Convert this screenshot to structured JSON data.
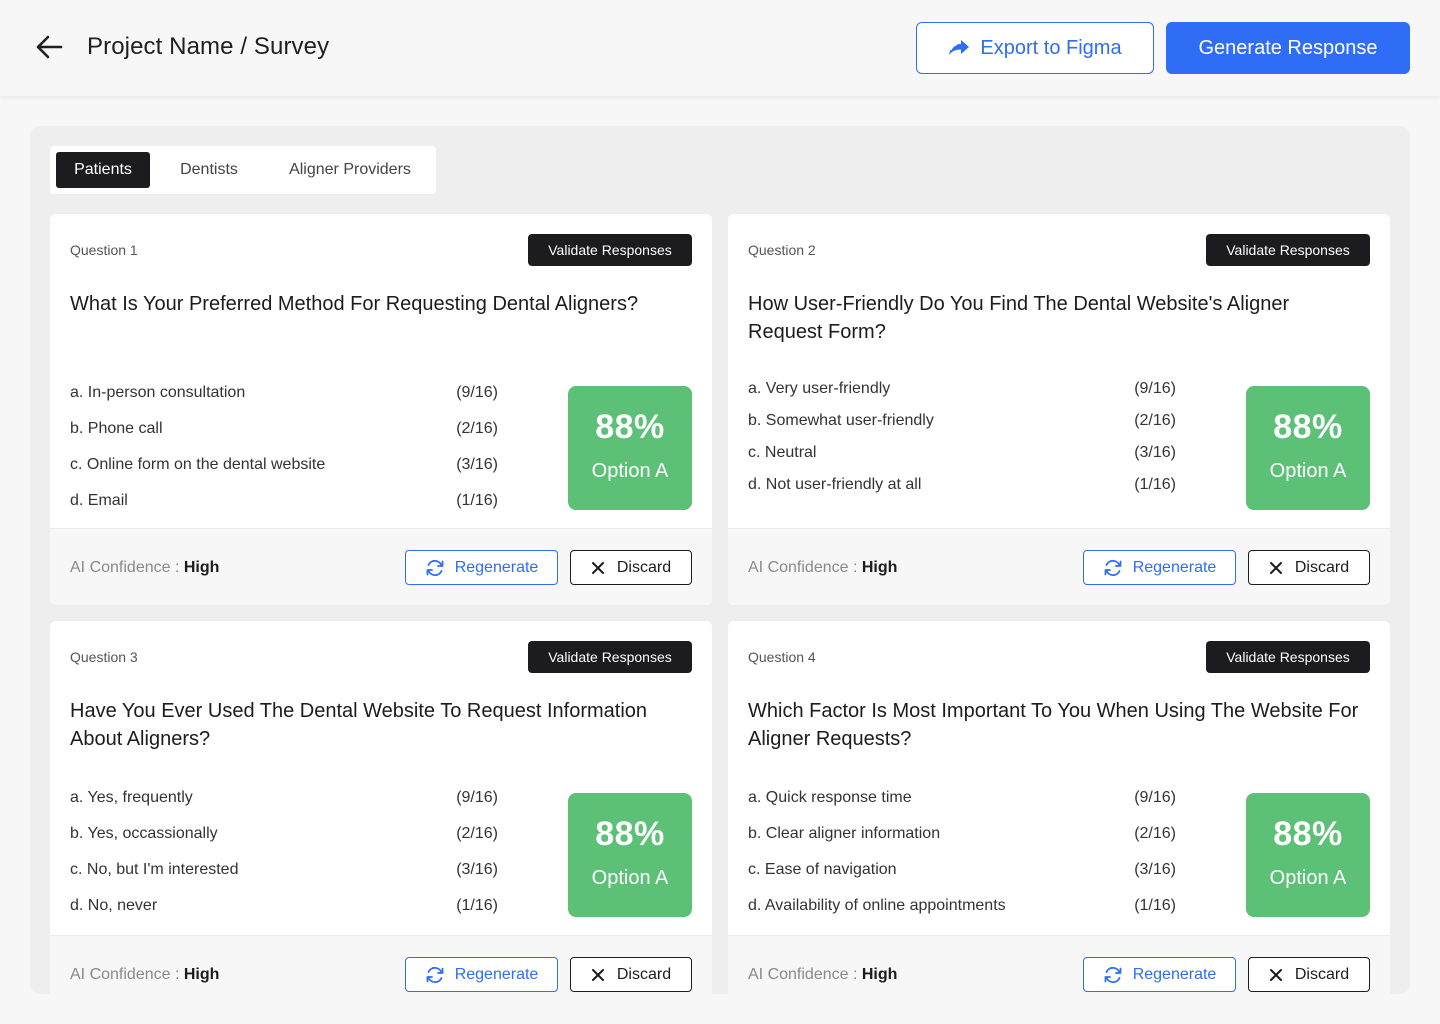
{
  "header": {
    "title": "Project Name / Survey",
    "export_label": "Export to Figma",
    "generate_label": "Generate Response"
  },
  "tabs": [
    {
      "label": "Patients",
      "active": true
    },
    {
      "label": "Dentists",
      "active": false
    },
    {
      "label": "Aligner Providers",
      "active": false
    }
  ],
  "card_labels": {
    "validate": "Validate Responses",
    "confidence_label": "AI Confidence : ",
    "regenerate": "Regenerate",
    "discard": "Discard"
  },
  "questions": [
    {
      "number": "Question 1",
      "title": "What Is Your Preferred Method For Requesting Dental Aligners?",
      "options": [
        {
          "text": "a. In-person consultation",
          "count": "(9/16)"
        },
        {
          "text": "b.  Phone call",
          "count": "(2/16)"
        },
        {
          "text": "c. Online form on the dental website",
          "count": "(3/16)"
        },
        {
          "text": "d. Email",
          "count": "(1/16)"
        }
      ],
      "percent": "88%",
      "result_option": "Option A",
      "confidence": "High"
    },
    {
      "number": "Question 2",
      "title": "How User-Friendly Do You Find The Dental Website's Aligner Request Form?",
      "options": [
        {
          "text": "a. Very user-friendly",
          "count": "(9/16)"
        },
        {
          "text": "b. Somewhat user-friendly",
          "count": "(2/16)"
        },
        {
          "text": "c. Neutral",
          "count": "(3/16)"
        },
        {
          "text": "d. Not user-friendly at all",
          "count": "(1/16)"
        }
      ],
      "percent": "88%",
      "result_option": "Option A",
      "confidence": "High"
    },
    {
      "number": "Question 3",
      "title": "Have You Ever Used The Dental Website To Request Information About Aligners?",
      "options": [
        {
          "text": "a. Yes, frequently",
          "count": "(9/16)"
        },
        {
          "text": "b.  Yes, occassionally",
          "count": "(2/16)"
        },
        {
          "text": "c. No, but I'm interested",
          "count": "(3/16)"
        },
        {
          "text": "d. No, never",
          "count": "(1/16)"
        }
      ],
      "percent": "88%",
      "result_option": "Option A",
      "confidence": "High"
    },
    {
      "number": "Question 4",
      "title": "Which Factor Is Most Important To You When Using The Website For Aligner Requests?",
      "options": [
        {
          "text": "a. Quick response time",
          "count": "(9/16)"
        },
        {
          "text": "b. Clear aligner information",
          "count": "(2/16)"
        },
        {
          "text": "c. Ease of navigation",
          "count": "(3/16)"
        },
        {
          "text": "d. Availability of online appointments",
          "count": "(1/16)"
        }
      ],
      "percent": "88%",
      "result_option": "Option A",
      "confidence": "High"
    }
  ],
  "colors": {
    "accent": "#2f6df6",
    "success": "#5cc077",
    "dark": "#1c1c1e"
  },
  "icons": {
    "back": "arrow-left-icon",
    "export": "share-forward-icon",
    "regenerate": "refresh-icon",
    "discard": "close-icon"
  }
}
